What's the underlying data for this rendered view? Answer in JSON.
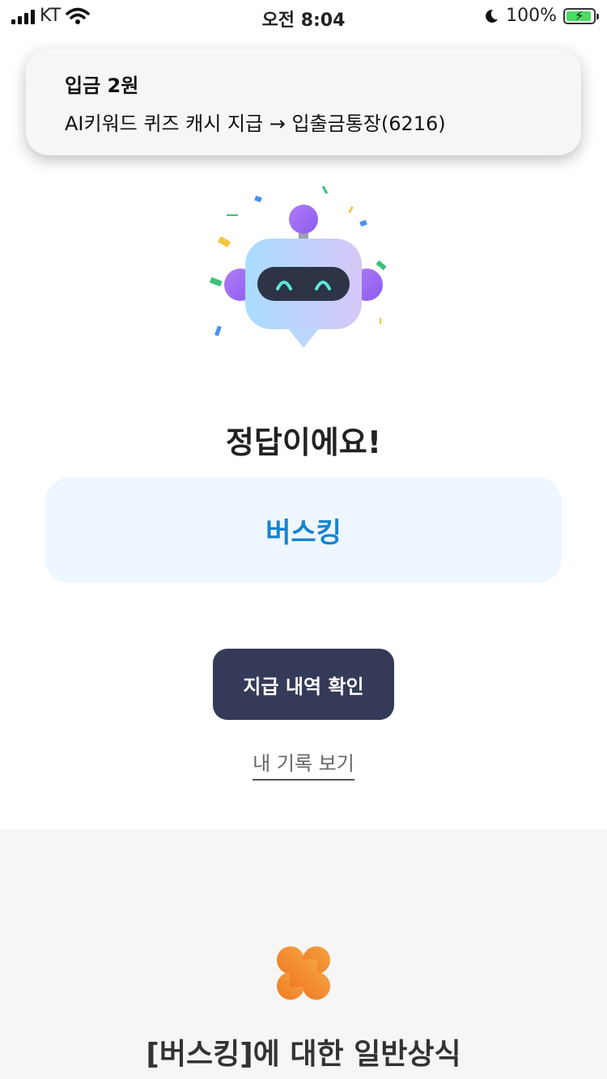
{
  "status_bar": {
    "carrier": "KT",
    "time": "오전 8:04",
    "battery": "100%"
  },
  "notification": {
    "title": "입금 2원",
    "body": "AI키워드 퀴즈 캐시 지급 → 입출금통장(6216)"
  },
  "result": {
    "headline": "정답이에요!",
    "answer": "버스킹"
  },
  "actions": {
    "payment_history_label": "지급 내역 확인",
    "my_records_label": "내 기록 보기"
  },
  "knowledge_section": {
    "title": "[버스킹]에 대한 일반상식"
  },
  "colors": {
    "accent_blue": "#1583d1",
    "answer_bg": "#eef7ff",
    "button_dark": "#343a57",
    "clover_orange": "#f2892f"
  }
}
